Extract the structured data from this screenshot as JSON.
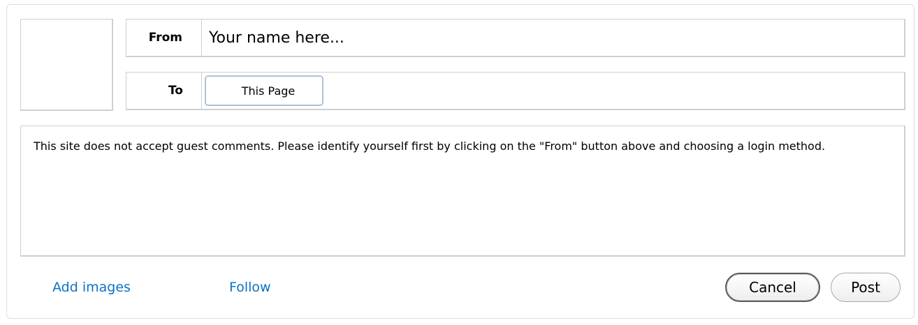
{
  "form": {
    "from_label": "From",
    "from_value": "Your name here...",
    "to_label": "To",
    "to_value": "This Page",
    "message": "This site does not accept guest comments. Please identify yourself first by clicking on the \"From\" button above and choosing a login method."
  },
  "footer": {
    "add_images": "Add images",
    "follow": "Follow",
    "cancel": "Cancel",
    "post": "Post"
  },
  "colors": {
    "link": "#0b72c6",
    "border": "#cfcfcf",
    "chip_border": "#a9c2dc"
  }
}
